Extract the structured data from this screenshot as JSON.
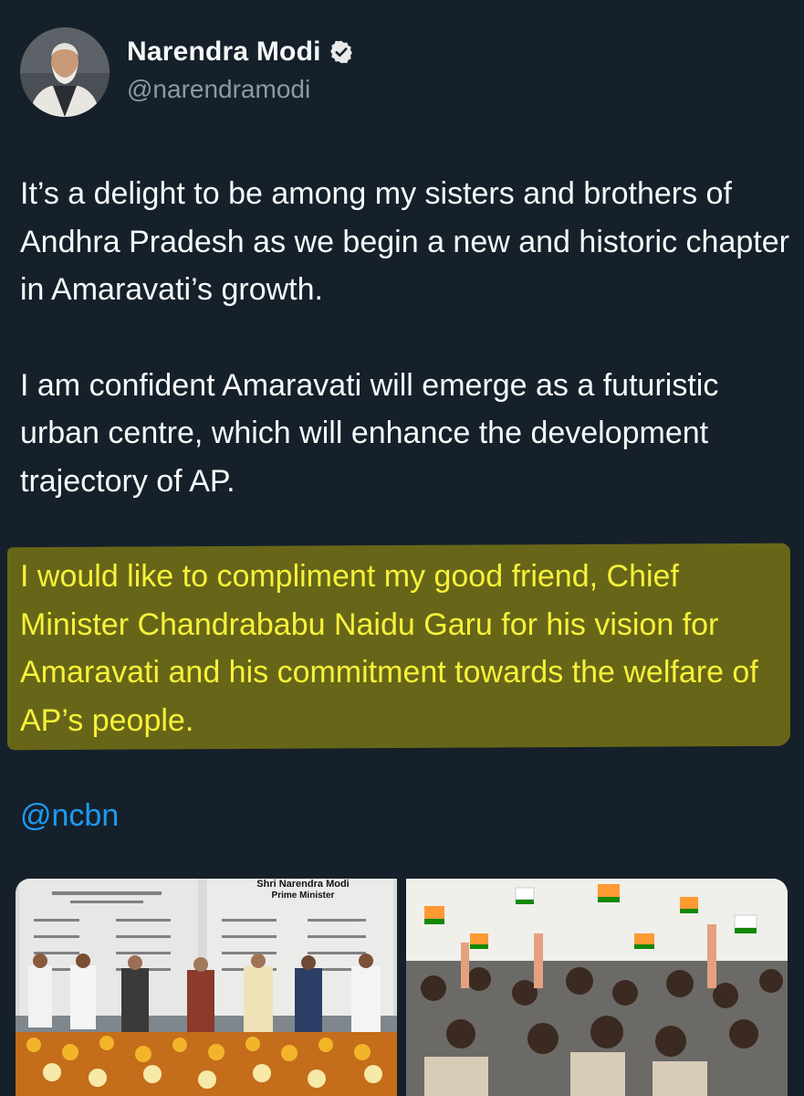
{
  "author": {
    "display_name": "Narendra Modi",
    "handle": "@narendramodi",
    "verified": true,
    "avatar_icon": "profile-photo"
  },
  "tweet": {
    "paragraph_1": "It’s a delight to be among my sisters and brothers of Andhra Pradesh as we begin a new and historic chapter in Amaravati’s growth.",
    "paragraph_2": "I am confident Amaravati will emerge as a futuristic urban centre, which will enhance the development trajectory of AP.",
    "paragraph_3_highlighted": "I would like to compliment my good friend, Chief Minister Chandrababu Naidu Garu for his vision for Amaravati and his commitment towards the welfare of AP’s people.",
    "mention": "@ncbn"
  },
  "media": {
    "image_1": {
      "stage_title": "Shri Narendra Modi",
      "stage_subtitle": "Prime Minister"
    },
    "image_2": {}
  },
  "colors": {
    "background": "#15202b",
    "text": "#f7f9f9",
    "secondary_text": "#8b98a5",
    "link": "#1d9bf0",
    "verified_badge": "#e7e9ea",
    "highlight_text": "#f6f13a",
    "highlight_bg": "#6f6d17"
  }
}
